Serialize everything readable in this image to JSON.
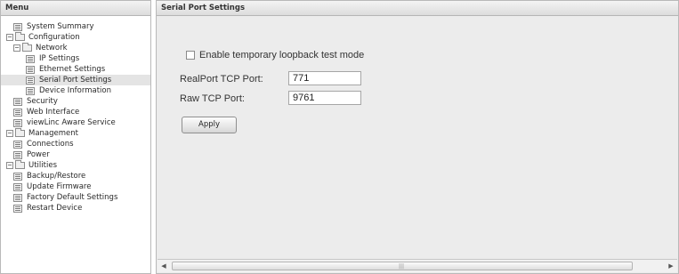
{
  "menu": {
    "title": "Menu",
    "tree": [
      {
        "label": "System Summary",
        "level": 1,
        "type": "page"
      },
      {
        "label": "Configuration",
        "level": 0,
        "type": "folder",
        "toggle": "−"
      },
      {
        "label": "Network",
        "level": 1,
        "type": "folder",
        "toggle": "−"
      },
      {
        "label": "IP Settings",
        "level": 2,
        "type": "page"
      },
      {
        "label": "Ethernet Settings",
        "level": 2,
        "type": "page"
      },
      {
        "label": "Serial Port Settings",
        "level": 2,
        "type": "page",
        "selected": true
      },
      {
        "label": "Device Information",
        "level": 2,
        "type": "page"
      },
      {
        "label": "Security",
        "level": 1,
        "type": "page"
      },
      {
        "label": "Web Interface",
        "level": 1,
        "type": "page"
      },
      {
        "label": "viewLinc Aware Service",
        "level": 1,
        "type": "page"
      },
      {
        "label": "Management",
        "level": 0,
        "type": "folder",
        "toggle": "−"
      },
      {
        "label": "Connections",
        "level": 1,
        "type": "page"
      },
      {
        "label": "Power",
        "level": 1,
        "type": "page"
      },
      {
        "label": "Utilities",
        "level": 0,
        "type": "folder",
        "toggle": "−"
      },
      {
        "label": "Backup/Restore",
        "level": 1,
        "type": "page"
      },
      {
        "label": "Update Firmware",
        "level": 1,
        "type": "page"
      },
      {
        "label": "Factory Default Settings",
        "level": 1,
        "type": "page"
      },
      {
        "label": "Restart Device",
        "level": 1,
        "type": "page"
      }
    ]
  },
  "content": {
    "title": "Serial Port Settings",
    "loopback_label": "Enable temporary loopback test mode",
    "loopback_checked": false,
    "realport_label": "RealPort TCP Port:",
    "realport_value": "771",
    "raw_label": "Raw TCP Port:",
    "raw_value": "9761",
    "apply_label": "Apply"
  },
  "scrollbar": {
    "left_arrow": "◀",
    "right_arrow": "▶",
    "grip": "|||"
  }
}
